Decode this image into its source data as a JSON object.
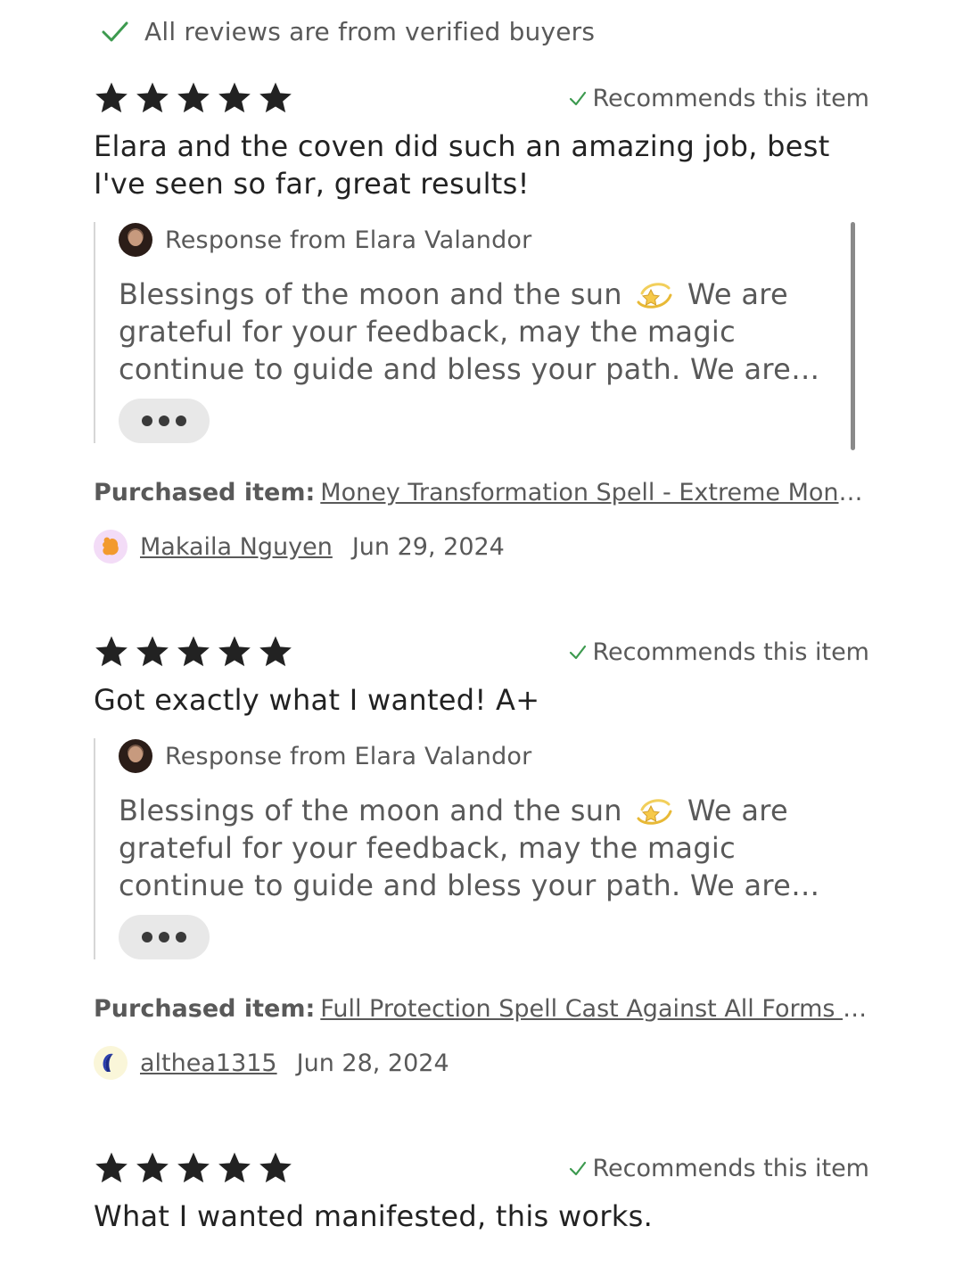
{
  "header": {
    "verified_text": "All reviews are from verified buyers"
  },
  "colors": {
    "check_green": "#3d9a4f",
    "star": "#222222",
    "text_primary": "#222222",
    "text_secondary": "#595959",
    "pill_bg": "#e8e8e8"
  },
  "reviews": [
    {
      "rating": 5,
      "recommends": "Recommends this item",
      "text": "Elara and the coven did such an amazing job, best I've seen so far, great results!",
      "response_label": "Response from Elara Valandor",
      "response_text_before": "Blessings of the moon and the sun",
      "response_emoji": "dizzy-star-emoji",
      "response_text_after": "We are grateful for your feedback, may the magic continue to guide and bless your path. We are with you",
      "purchased_label": "Purchased item:",
      "purchased_item": "Money Transformation Spell - Extreme Money ...",
      "reviewer_name": "Makaila Nguyen",
      "date": "Jun 29, 2024",
      "avatar_icon": "orange-blob-avatar-icon"
    },
    {
      "rating": 5,
      "recommends": "Recommends this item",
      "text": "Got exactly what I wanted! A+",
      "response_label": "Response from Elara Valandor",
      "response_text_before": "Blessings of the moon and the sun",
      "response_emoji": "dizzy-star-emoji",
      "response_text_after": "We are grateful for your feedback, may the magic continue to guide and bless your path. We are with you",
      "purchased_label": "Purchased item:",
      "purchased_item": "Full Protection Spell Cast Against All Forms of ...",
      "reviewer_name": "althea1315",
      "date": "Jun 28, 2024",
      "avatar_icon": "blue-crescent-avatar-icon"
    },
    {
      "rating": 5,
      "recommends": "Recommends this item",
      "text": "What I wanted manifested, this works."
    }
  ]
}
